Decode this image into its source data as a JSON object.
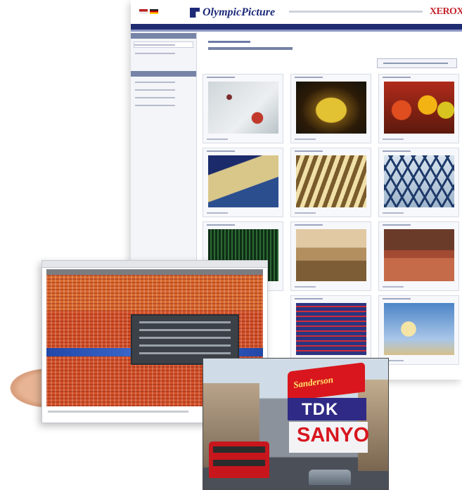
{
  "app": {
    "title": "OlympicPicture",
    "brand": "XEROX",
    "flags": [
      "english-flag-icon",
      "german-flag-icon"
    ],
    "accent": "#202c72",
    "brand_color": "#c4242c"
  },
  "photos": {
    "piccadilly": {
      "sign_top": "Sanderson",
      "sign_middle": "TDK",
      "sign_bottom": "SANYO"
    }
  }
}
